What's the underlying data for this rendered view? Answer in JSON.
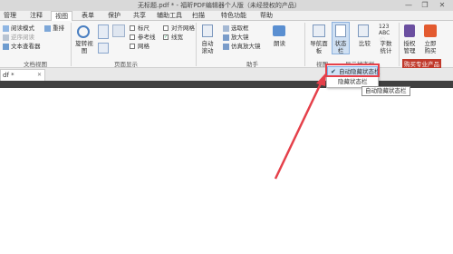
{
  "window": {
    "title": "无标题.pdf * - 福昕PDF编辑器个人版（未经授权的产品）",
    "minimize_icon": "minimize-icon",
    "restore_icon": "restore-icon",
    "close_icon": "close-icon"
  },
  "menu": {
    "tabs": [
      {
        "label": "管理"
      },
      {
        "label": "注释"
      },
      {
        "label": "视图"
      },
      {
        "label": "表单"
      },
      {
        "label": "保护"
      },
      {
        "label": "共享"
      },
      {
        "label": "辅助工具"
      },
      {
        "label": "扫描"
      },
      {
        "label": "特色功能"
      },
      {
        "label": "帮助"
      }
    ],
    "active_tab": "视图"
  },
  "ribbon": {
    "doc_views": {
      "reading_mode": "阅读模式",
      "reverse_view": "逆序阅读",
      "text_viewer": "文本查看器",
      "reflow": "重排",
      "group_label": "文档视图"
    },
    "page_display": {
      "rotate_view": "旋转视图",
      "check_ruler": "标尺",
      "check_reference": "参考线",
      "check_grid": "网格",
      "check_align_grid": "对齐网格",
      "check_lineweight": "线宽",
      "group_label": "页面显示"
    },
    "assist": {
      "auto_scroll": "自动滚动",
      "marquee": "选取框",
      "magnifier": "放大镜",
      "loupe": "仿真放大镜",
      "read_aloud": "朗读",
      "group_label": "助手"
    },
    "right_tools": {
      "nav_panel": "导航面板",
      "status_bar": "状态栏",
      "compare": "比较",
      "word_count": "字数统计",
      "license_mgmt": "授权管理",
      "buy_now": "立即购买",
      "view_group_label": "视图",
      "show_status_bar": "显示状态栏",
      "product_group_label": "购买专业产品"
    }
  },
  "document": {
    "tab_label": "df *",
    "close_icon": "close-icon"
  },
  "status_dropdown": {
    "items": [
      {
        "label": "自动隐藏状态栏",
        "checked": true
      },
      {
        "label": "隐藏状态栏",
        "checked": false
      }
    ],
    "tooltip": "自动隐藏状态栏"
  },
  "colors": {
    "highlight_box": "#e5404a",
    "arrow": "#e5404a",
    "selected_item": "#cfe2f6",
    "buy_now_bg": "#c0392b"
  }
}
